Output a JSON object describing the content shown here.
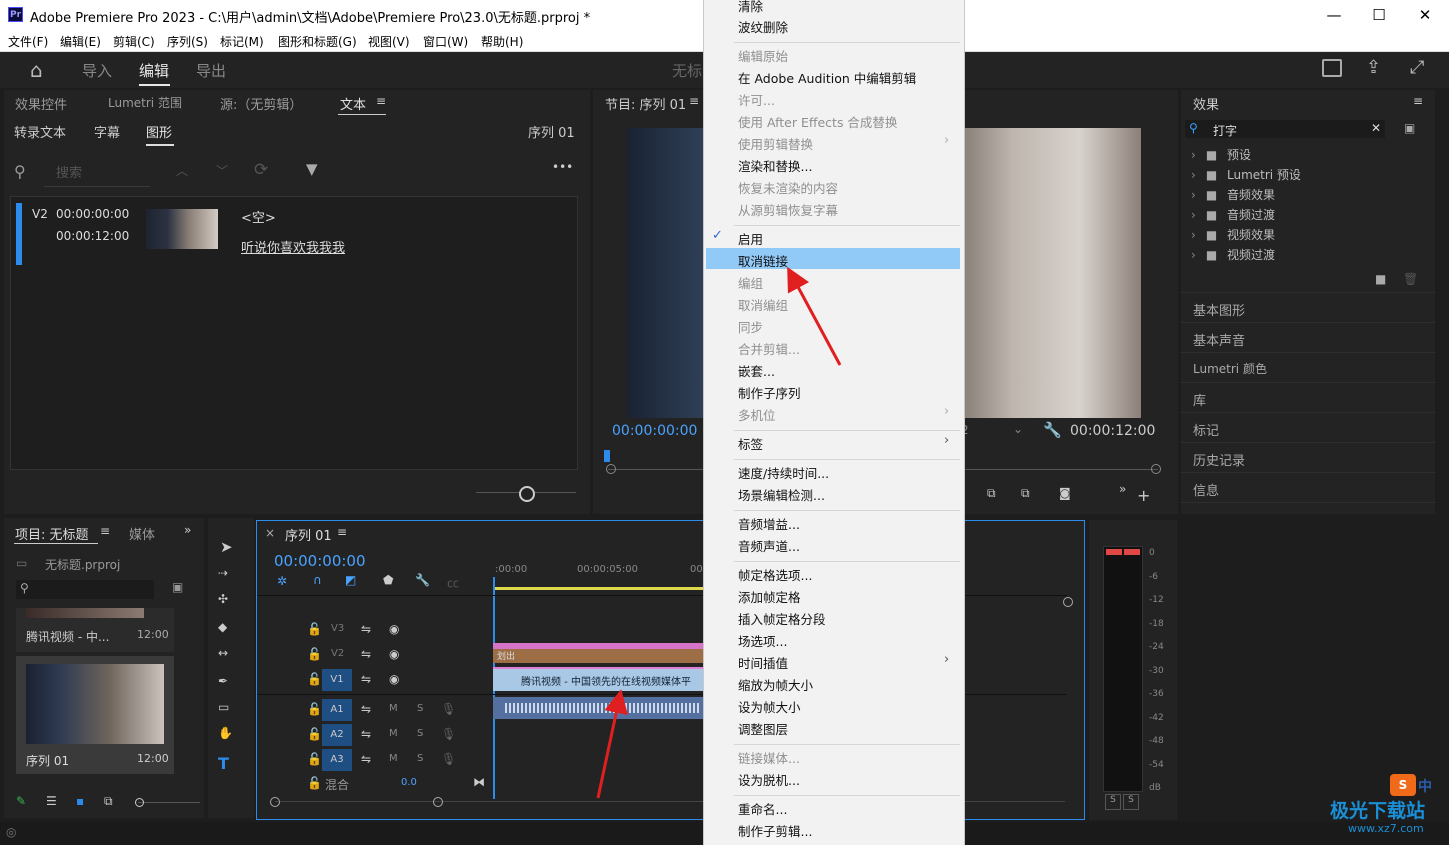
{
  "window": {
    "app_badge": "Pr",
    "title": "Adobe Premiere Pro 2023 - C:\\用户\\admin\\文档\\Adobe\\Premiere Pro\\23.0\\无标题.prproj *",
    "minimize": "—",
    "maximize": "☐",
    "close": "✕"
  },
  "menubar": [
    "文件(F)",
    "编辑(E)",
    "剪辑(C)",
    "序列(S)",
    "标记(M)",
    "图形和标题(G)",
    "视图(V)",
    "窗口(W)",
    "帮助(H)"
  ],
  "header": {
    "tabs": [
      "导入",
      "编辑",
      "导出"
    ],
    "active_tab": "编辑",
    "center_title": "无标"
  },
  "left_panel": {
    "tabs": [
      "效果控件",
      "Lumetri 范围",
      "源:（无剪辑）",
      "文本"
    ],
    "subtabs": [
      "转录文本",
      "字幕",
      "图形"
    ],
    "sequence_label": "序列 01",
    "search_placeholder": "搜索",
    "item": {
      "track": "V2",
      "start": "00:00:00:00",
      "end": "00:00:12:00",
      "empty_label": "<空>",
      "text": "听说你喜欢我我我"
    }
  },
  "program_monitor": {
    "title": "节目: 序列 01",
    "timecode_left": "00:00:00:00",
    "timecode_right": "00:00:12:00",
    "zoom_fragment": "2"
  },
  "effects_panel": {
    "title": "效果",
    "search_value": "打字",
    "tree": [
      "预设",
      "Lumetri 预设",
      "音频效果",
      "音频过渡",
      "视频效果",
      "视频过渡"
    ],
    "collapsed_panels": [
      "基本图形",
      "基本声音",
      "Lumetri 颜色",
      "库",
      "标记",
      "历史记录",
      "信息"
    ]
  },
  "project_panel": {
    "title": "项目: 无标题",
    "tab2": "媒体",
    "file": "无标题.prproj",
    "items": [
      {
        "name": "腾讯视频 - 中...",
        "duration": "12:00"
      },
      {
        "name": "序列 01",
        "duration": "12:00"
      }
    ]
  },
  "timeline": {
    "title": "序列 01",
    "timecode": "00:00:00:00",
    "ruler": [
      ":00:00",
      "00:00:05:00",
      "00",
      "00",
      "00:00:2"
    ],
    "video_tracks": [
      "V3",
      "V2",
      "V1"
    ],
    "audio_tracks": [
      "A1",
      "A2",
      "A3"
    ],
    "mix_label": "混合",
    "mix_value": "0.0",
    "mute_label": "M",
    "solo_label": "S",
    "clip_v2": "划出",
    "clip_v1": "腾讯视频 - 中国领先的在线视频媒体平"
  },
  "audio_meter": {
    "scale": [
      "0",
      "-6",
      "-12",
      "-18",
      "-24",
      "-30",
      "-36",
      "-42",
      "-48",
      "-54",
      "dB"
    ],
    "solo_buttons": [
      "S",
      "S"
    ]
  },
  "context_menu": {
    "items": [
      {
        "label": "清除",
        "disabled": false
      },
      {
        "label": "波纹删除",
        "disabled": false
      },
      {
        "sep": true
      },
      {
        "label": "编辑原始",
        "disabled": true
      },
      {
        "label": "在 Adobe Audition 中编辑剪辑",
        "disabled": false
      },
      {
        "label": "许可...",
        "disabled": true
      },
      {
        "label": "使用 After Effects 合成替换",
        "disabled": true
      },
      {
        "label": "使用剪辑替换",
        "disabled": true,
        "submenu": true
      },
      {
        "label": "渲染和替换...",
        "disabled": false
      },
      {
        "label": "恢复未渲染的内容",
        "disabled": true
      },
      {
        "label": "从源剪辑恢复字幕",
        "disabled": true
      },
      {
        "sep": true
      },
      {
        "label": "启用",
        "disabled": false,
        "checked": true
      },
      {
        "label": "取消链接",
        "disabled": false,
        "highlighted": true
      },
      {
        "label": "编组",
        "disabled": true
      },
      {
        "label": "取消编组",
        "disabled": true
      },
      {
        "label": "同步",
        "disabled": true
      },
      {
        "label": "合并剪辑...",
        "disabled": true
      },
      {
        "label": "嵌套...",
        "disabled": false
      },
      {
        "label": "制作子序列",
        "disabled": false
      },
      {
        "label": "多机位",
        "disabled": true,
        "submenu": true
      },
      {
        "sep": true
      },
      {
        "label": "标签",
        "disabled": false,
        "submenu": true
      },
      {
        "sep": true
      },
      {
        "label": "速度/持续时间...",
        "disabled": false
      },
      {
        "label": "场景编辑检测...",
        "disabled": false
      },
      {
        "sep": true
      },
      {
        "label": "音频增益...",
        "disabled": false
      },
      {
        "label": "音频声道...",
        "disabled": false
      },
      {
        "sep": true
      },
      {
        "label": "帧定格选项...",
        "disabled": false
      },
      {
        "label": "添加帧定格",
        "disabled": false
      },
      {
        "label": "插入帧定格分段",
        "disabled": false
      },
      {
        "label": "场选项...",
        "disabled": false
      },
      {
        "label": "时间插值",
        "disabled": false,
        "submenu": true
      },
      {
        "label": "缩放为帧大小",
        "disabled": false
      },
      {
        "label": "设为帧大小",
        "disabled": false
      },
      {
        "label": "调整图层",
        "disabled": false
      },
      {
        "sep": true
      },
      {
        "label": "链接媒体...",
        "disabled": true
      },
      {
        "label": "设为脱机...",
        "disabled": false
      },
      {
        "sep": true
      },
      {
        "label": "重命名...",
        "disabled": false
      },
      {
        "label": "制作子剪辑...",
        "disabled": false
      }
    ]
  },
  "watermark": {
    "text": "极光下载站",
    "url": "www.xz7.com",
    "badge": "中"
  },
  "colors": {
    "accent": "#2d8ceb",
    "timecode_blue": "#4aa3ff",
    "menu_highlight": "#91c9f7",
    "arrow_red": "#e02020"
  }
}
